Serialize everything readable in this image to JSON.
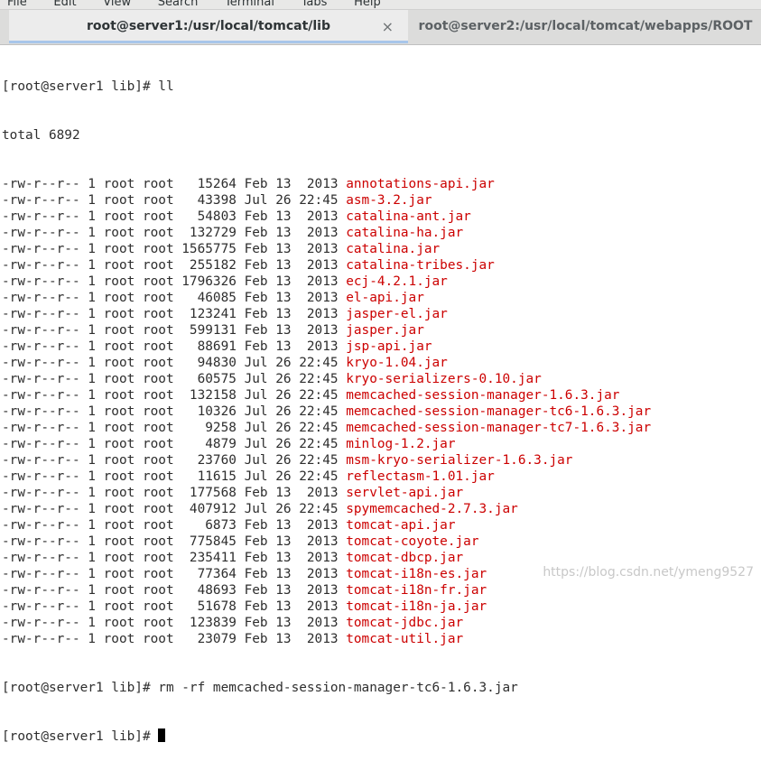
{
  "menubar": {
    "items": [
      "File",
      "Edit",
      "View",
      "Search",
      "Terminal",
      "Tabs",
      "Help"
    ]
  },
  "tabs": [
    {
      "title": "root@server1:/usr/local/tomcat/lib",
      "active": true
    },
    {
      "title": "root@server2:/usr/local/tomcat/webapps/ROOT",
      "active": false
    }
  ],
  "terminal": {
    "prompt": "[root@server1 lib]# ",
    "command1": "ll",
    "total": "total 6892",
    "listing": [
      {
        "meta": "-rw-r--r-- 1 root root   15264 Feb 13  2013 ",
        "name": "annotations-api.jar"
      },
      {
        "meta": "-rw-r--r-- 1 root root   43398 Jul 26 22:45 ",
        "name": "asm-3.2.jar"
      },
      {
        "meta": "-rw-r--r-- 1 root root   54803 Feb 13  2013 ",
        "name": "catalina-ant.jar"
      },
      {
        "meta": "-rw-r--r-- 1 root root  132729 Feb 13  2013 ",
        "name": "catalina-ha.jar"
      },
      {
        "meta": "-rw-r--r-- 1 root root 1565775 Feb 13  2013 ",
        "name": "catalina.jar"
      },
      {
        "meta": "-rw-r--r-- 1 root root  255182 Feb 13  2013 ",
        "name": "catalina-tribes.jar"
      },
      {
        "meta": "-rw-r--r-- 1 root root 1796326 Feb 13  2013 ",
        "name": "ecj-4.2.1.jar"
      },
      {
        "meta": "-rw-r--r-- 1 root root   46085 Feb 13  2013 ",
        "name": "el-api.jar"
      },
      {
        "meta": "-rw-r--r-- 1 root root  123241 Feb 13  2013 ",
        "name": "jasper-el.jar"
      },
      {
        "meta": "-rw-r--r-- 1 root root  599131 Feb 13  2013 ",
        "name": "jasper.jar"
      },
      {
        "meta": "-rw-r--r-- 1 root root   88691 Feb 13  2013 ",
        "name": "jsp-api.jar"
      },
      {
        "meta": "-rw-r--r-- 1 root root   94830 Jul 26 22:45 ",
        "name": "kryo-1.04.jar"
      },
      {
        "meta": "-rw-r--r-- 1 root root   60575 Jul 26 22:45 ",
        "name": "kryo-serializers-0.10.jar"
      },
      {
        "meta": "-rw-r--r-- 1 root root  132158 Jul 26 22:45 ",
        "name": "memcached-session-manager-1.6.3.jar"
      },
      {
        "meta": "-rw-r--r-- 1 root root   10326 Jul 26 22:45 ",
        "name": "memcached-session-manager-tc6-1.6.3.jar"
      },
      {
        "meta": "-rw-r--r-- 1 root root    9258 Jul 26 22:45 ",
        "name": "memcached-session-manager-tc7-1.6.3.jar"
      },
      {
        "meta": "-rw-r--r-- 1 root root    4879 Jul 26 22:45 ",
        "name": "minlog-1.2.jar"
      },
      {
        "meta": "-rw-r--r-- 1 root root   23760 Jul 26 22:45 ",
        "name": "msm-kryo-serializer-1.6.3.jar"
      },
      {
        "meta": "-rw-r--r-- 1 root root   11615 Jul 26 22:45 ",
        "name": "reflectasm-1.01.jar"
      },
      {
        "meta": "-rw-r--r-- 1 root root  177568 Feb 13  2013 ",
        "name": "servlet-api.jar"
      },
      {
        "meta": "-rw-r--r-- 1 root root  407912 Jul 26 22:45 ",
        "name": "spymemcached-2.7.3.jar"
      },
      {
        "meta": "-rw-r--r-- 1 root root    6873 Feb 13  2013 ",
        "name": "tomcat-api.jar"
      },
      {
        "meta": "-rw-r--r-- 1 root root  775845 Feb 13  2013 ",
        "name": "tomcat-coyote.jar"
      },
      {
        "meta": "-rw-r--r-- 1 root root  235411 Feb 13  2013 ",
        "name": "tomcat-dbcp.jar"
      },
      {
        "meta": "-rw-r--r-- 1 root root   77364 Feb 13  2013 ",
        "name": "tomcat-i18n-es.jar"
      },
      {
        "meta": "-rw-r--r-- 1 root root   48693 Feb 13  2013 ",
        "name": "tomcat-i18n-fr.jar"
      },
      {
        "meta": "-rw-r--r-- 1 root root   51678 Feb 13  2013 ",
        "name": "tomcat-i18n-ja.jar"
      },
      {
        "meta": "-rw-r--r-- 1 root root  123839 Feb 13  2013 ",
        "name": "tomcat-jdbc.jar"
      },
      {
        "meta": "-rw-r--r-- 1 root root   23079 Feb 13  2013 ",
        "name": "tomcat-util.jar"
      }
    ],
    "command2": "rm -rf memcached-session-manager-tc6-1.6.3.jar"
  },
  "watermark": "https://blog.csdn.net/ymeng9527",
  "colors": {
    "filename": "#cc0000",
    "tab_active": "#ececec",
    "tab_underline": "#a8c6ea"
  }
}
